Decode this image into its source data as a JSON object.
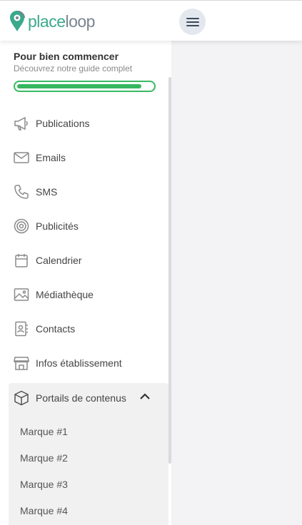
{
  "brand": {
    "part1": "place",
    "part2": "loop",
    "accent": "#3aa98c",
    "muted": "#7a8490"
  },
  "onboarding": {
    "title": "Pour bien commencer",
    "subtitle": "Découvrez notre guide complet",
    "progress_percent": 92,
    "color": "#35b660"
  },
  "nav": {
    "items": [
      {
        "label": "Publications",
        "icon": "megaphone-icon"
      },
      {
        "label": "Emails",
        "icon": "envelope-icon"
      },
      {
        "label": "SMS",
        "icon": "phone-icon"
      },
      {
        "label": "Publicités",
        "icon": "target-icon"
      },
      {
        "label": "Calendrier",
        "icon": "calendar-icon"
      },
      {
        "label": "Médiathèque",
        "icon": "image-icon"
      },
      {
        "label": "Contacts",
        "icon": "contact-book-icon"
      },
      {
        "label": "Infos établissement",
        "icon": "storefront-icon"
      }
    ],
    "group": {
      "label": "Portails de contenus",
      "icon": "box-icon",
      "expanded": true,
      "children": [
        "Marque #1",
        "Marque #2",
        "Marque #3",
        "Marque #4"
      ]
    }
  }
}
